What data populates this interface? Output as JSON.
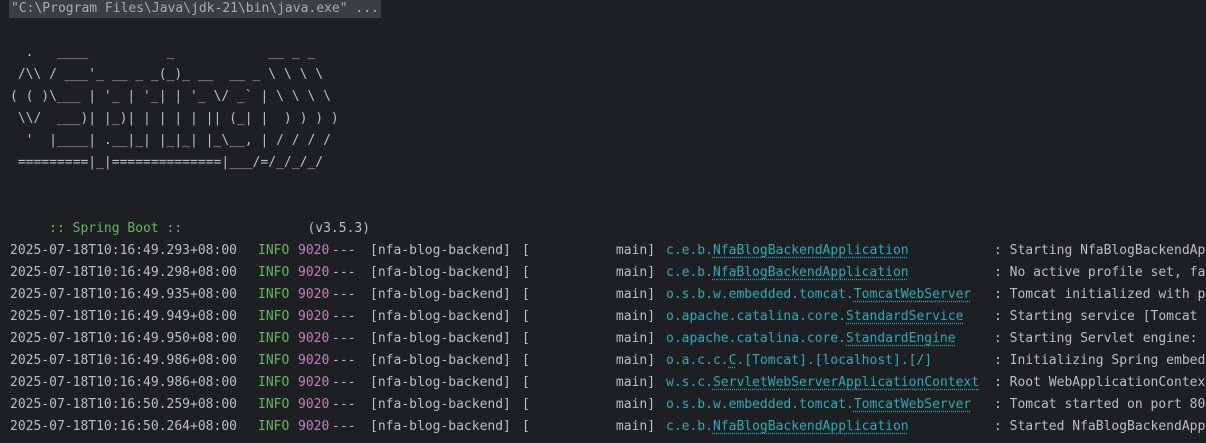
{
  "console": {
    "command": "\"C:\\Program Files\\Java\\jdk-21\\bin\\java.exe\" ...",
    "banner": "  .   ____          _            __ _ _\n /\\\\ / ___'_ __ _ _(_)_ __  __ _ \\ \\ \\ \\\n( ( )\\___ | '_ | '_| | '_ \\/ _` | \\ \\ \\ \\\n \\\\/  ___)| |_)| | | | | || (_| |  ) ) ) )\n  '  |____| .__|_| |_|_| |_\\__, | / / / /\n =========|_|==============|___/=/_/_/_/",
    "spring_label": " :: Spring Boot ::",
    "spring_version": "(v3.5.3)",
    "colors": {
      "background": "#1e1f22",
      "text": "#bcbec4",
      "info": "#5fb85f",
      "pid": "#c77dbb",
      "logger": "#2aacb8"
    },
    "logs": [
      {
        "ts": "2025-07-18T10:16:49.293+08:00",
        "level": "INFO",
        "pid": "9020",
        "sep": "---",
        "app": "[nfa-blog-backend]",
        "thread": "[           main]",
        "logger_pkg": "c.e.b.",
        "logger_cls": "NfaBlogBackendApplication",
        "message": ": Starting NfaBlogBackendAp"
      },
      {
        "ts": "2025-07-18T10:16:49.298+08:00",
        "level": "INFO",
        "pid": "9020",
        "sep": "---",
        "app": "[nfa-blog-backend]",
        "thread": "[           main]",
        "logger_pkg": "c.e.b.",
        "logger_cls": "NfaBlogBackendApplication",
        "message": ": No active profile set, fa"
      },
      {
        "ts": "2025-07-18T10:16:49.935+08:00",
        "level": "INFO",
        "pid": "9020",
        "sep": "---",
        "app": "[nfa-blog-backend]",
        "thread": "[           main]",
        "logger_pkg": "o.s.b.w.embedded.tomcat.",
        "logger_cls": "TomcatWebServer",
        "message": ": Tomcat initialized with p"
      },
      {
        "ts": "2025-07-18T10:16:49.949+08:00",
        "level": "INFO",
        "pid": "9020",
        "sep": "---",
        "app": "[nfa-blog-backend]",
        "thread": "[           main]",
        "logger_pkg": "o.apache.catalina.core.",
        "logger_cls": "StandardService",
        "message": ": Starting service [Tomcat"
      },
      {
        "ts": "2025-07-18T10:16:49.950+08:00",
        "level": "INFO",
        "pid": "9020",
        "sep": "---",
        "app": "[nfa-blog-backend]",
        "thread": "[           main]",
        "logger_pkg": "o.apache.catalina.core.",
        "logger_cls": "StandardEngine",
        "message": ": Starting Servlet engine:"
      },
      {
        "ts": "2025-07-18T10:16:49.986+08:00",
        "level": "INFO",
        "pid": "9020",
        "sep": "---",
        "app": "[nfa-blog-backend]",
        "thread": "[           main]",
        "logger_pkg": "o.a.c.c.",
        "logger_cls": "C",
        "logger_rest": ".[Tomcat].[localhost].[/]",
        "message": ": Initializing Spring embed"
      },
      {
        "ts": "2025-07-18T10:16:49.986+08:00",
        "level": "INFO",
        "pid": "9020",
        "sep": "---",
        "app": "[nfa-blog-backend]",
        "thread": "[           main]",
        "logger_pkg": "w.s.c.",
        "logger_cls": "ServletWebServerApplicationContext",
        "message": ": Root WebApplicationContex"
      },
      {
        "ts": "2025-07-18T10:16:50.259+08:00",
        "level": "INFO",
        "pid": "9020",
        "sep": "---",
        "app": "[nfa-blog-backend]",
        "thread": "[           main]",
        "logger_pkg": "o.s.b.w.embedded.tomcat.",
        "logger_cls": "TomcatWebServer",
        "message": ": Tomcat started on port 80"
      },
      {
        "ts": "2025-07-18T10:16:50.264+08:00",
        "level": "INFO",
        "pid": "9020",
        "sep": "---",
        "app": "[nfa-blog-backend]",
        "thread": "[           main]",
        "logger_pkg": "c.e.b.",
        "logger_cls": "NfaBlogBackendApplication",
        "message": ": Started NfaBlogBackendApp"
      }
    ]
  }
}
